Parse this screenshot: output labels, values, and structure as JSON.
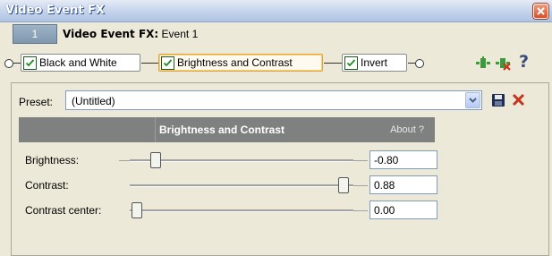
{
  "window": {
    "title": "Video Event FX"
  },
  "event": {
    "number": "1",
    "label_bold": "Video Event FX:",
    "label_rest": "Event 1"
  },
  "chain": {
    "items": [
      {
        "label": "Black and White",
        "checked": true,
        "active": false
      },
      {
        "label": "Brightness and Contrast",
        "checked": true,
        "active": true
      },
      {
        "label": "Invert",
        "checked": true,
        "active": false
      }
    ],
    "help": "?"
  },
  "preset": {
    "label": "Preset:",
    "value": "(Untitled)"
  },
  "fx": {
    "name": "Brightness and Contrast",
    "about": "About  ?",
    "params": [
      {
        "label": "Brightness:",
        "value": "-0.80",
        "level": 0.1
      },
      {
        "label": "Contrast:",
        "value": "0.88",
        "level": 0.94
      },
      {
        "label": "Contrast center:",
        "value": "0.00",
        "level": 0.0
      }
    ]
  },
  "colors": {
    "accent_close": "#d6502c",
    "delete_red": "#c8331b",
    "header_gray": "#7f8080"
  }
}
